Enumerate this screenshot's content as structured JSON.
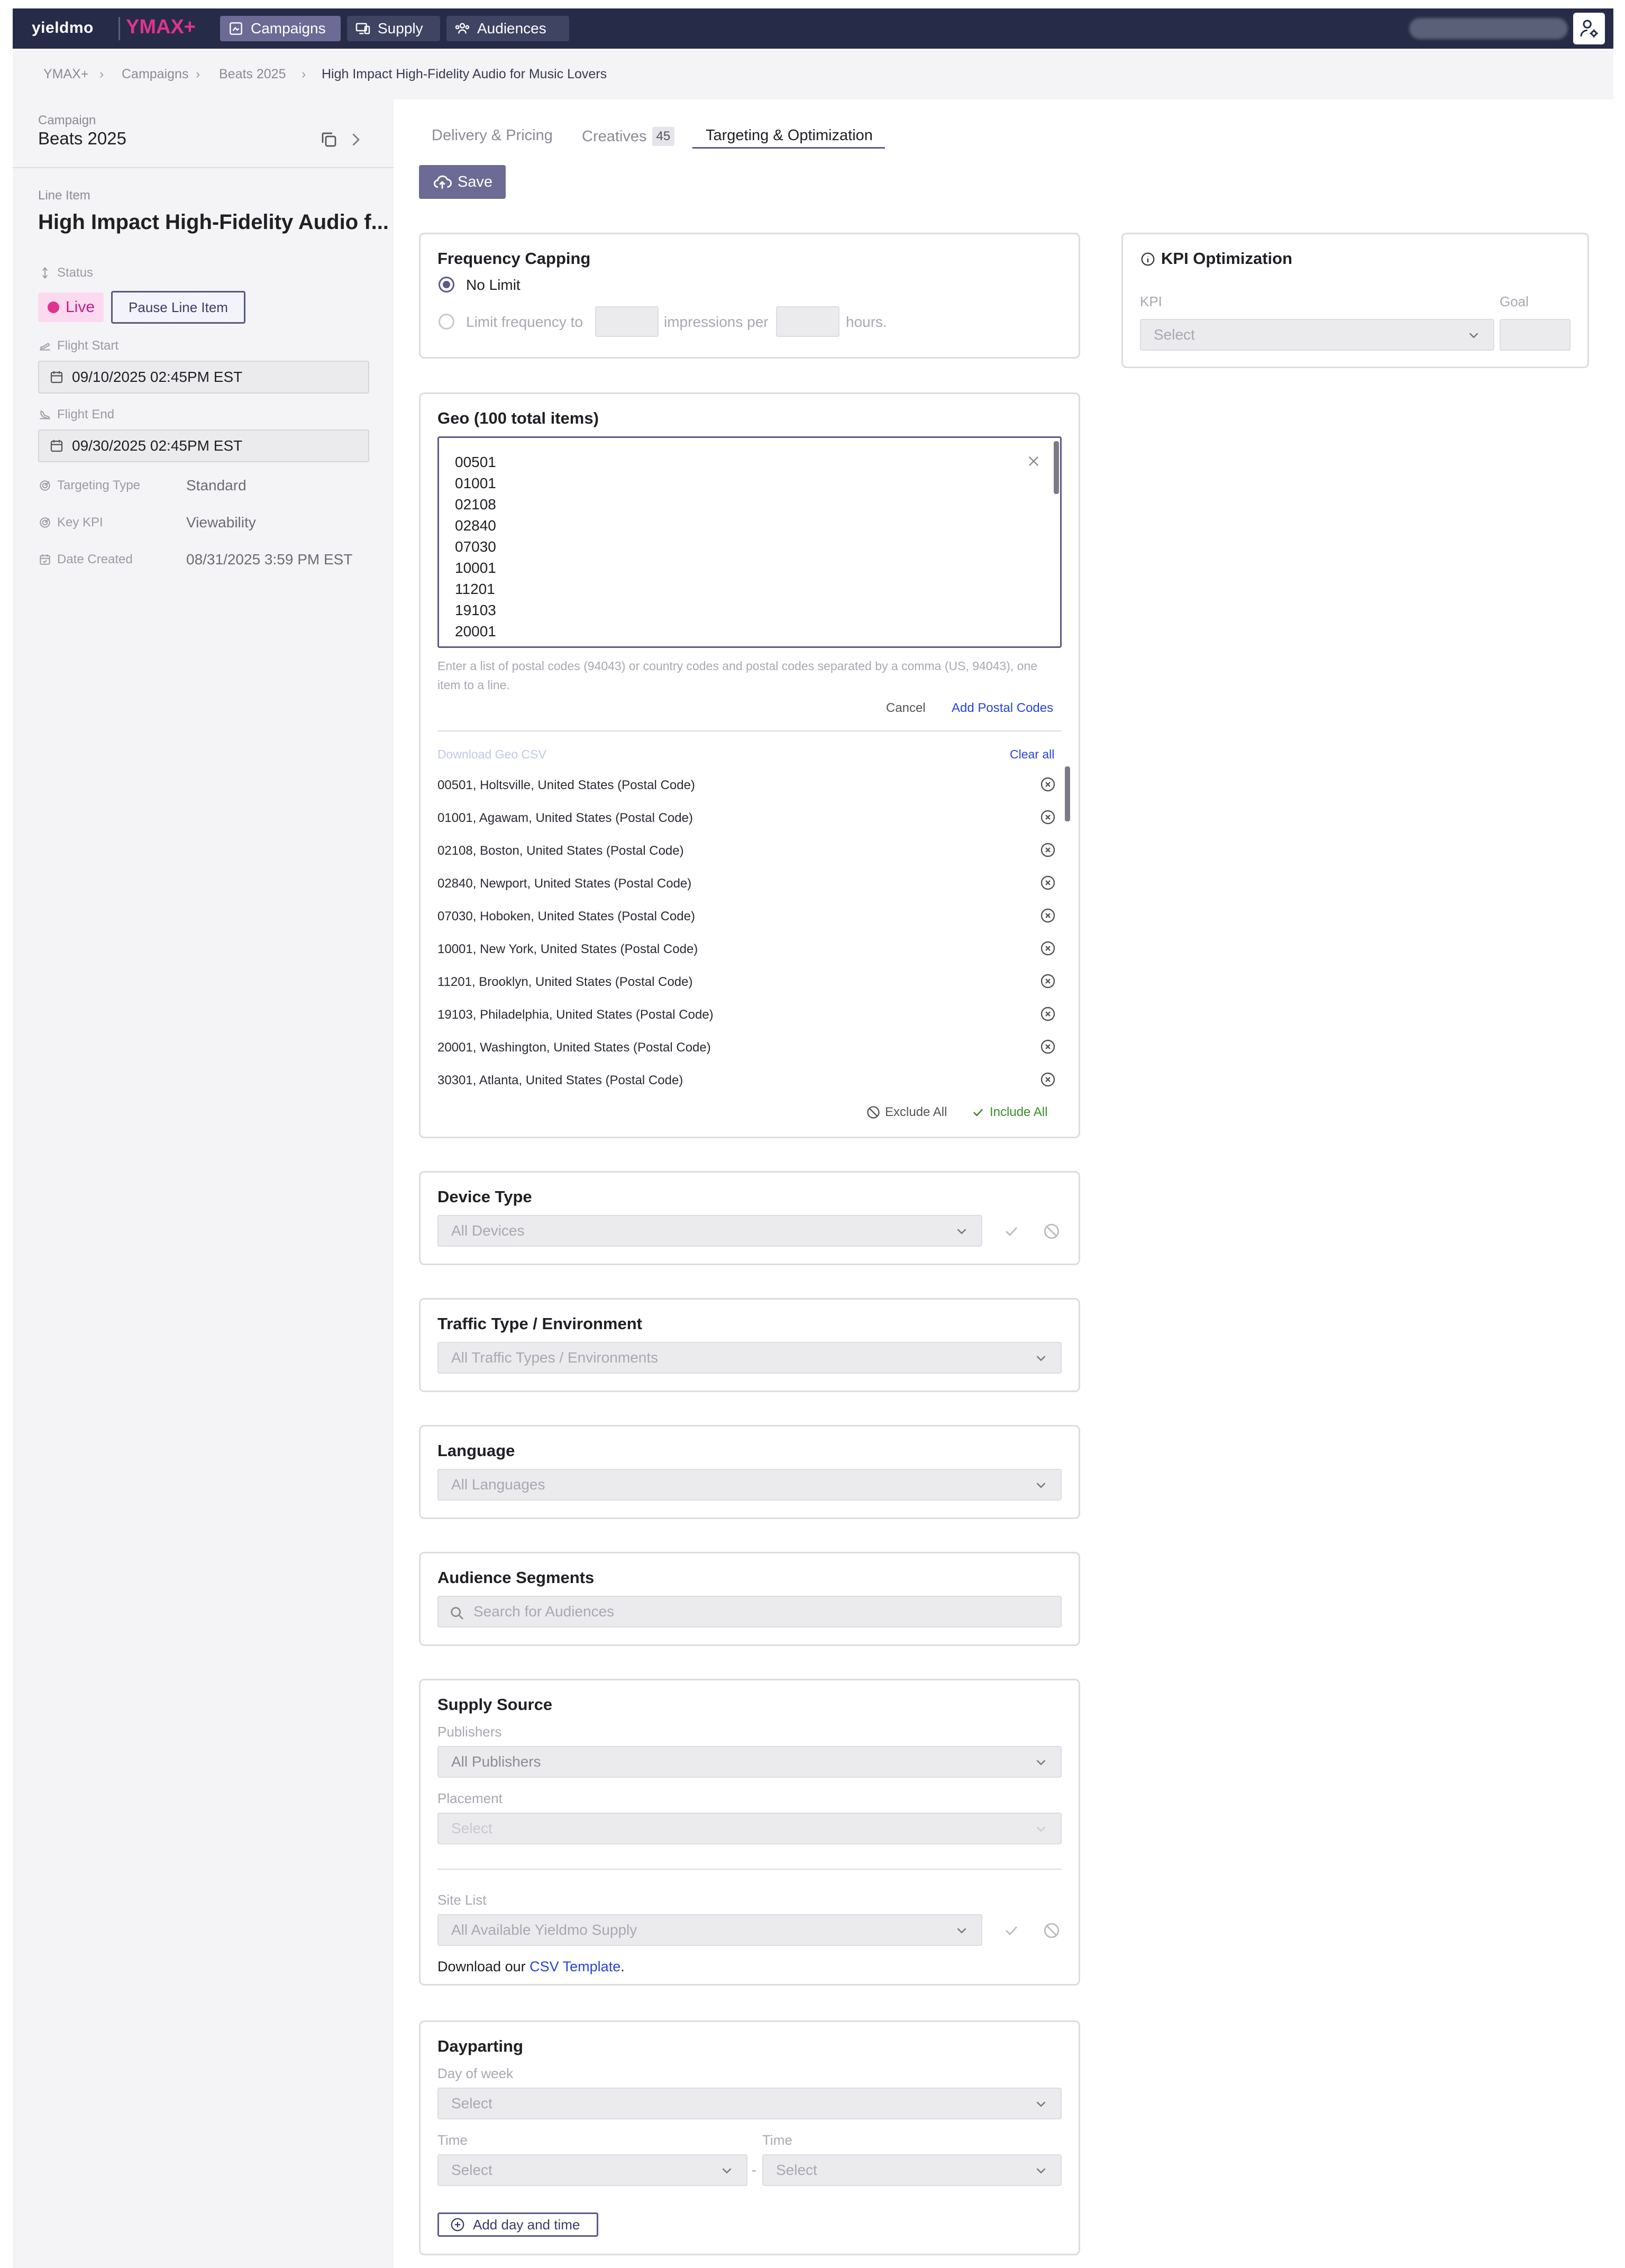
{
  "topnav": {
    "logo": "yieldmo",
    "product": "YMAX+",
    "items": [
      {
        "label": "Campaigns",
        "active": true
      },
      {
        "label": "Supply",
        "active": false
      },
      {
        "label": "Audiences",
        "active": false
      }
    ]
  },
  "breadcrumb": [
    "YMAX+",
    "Campaigns",
    "Beats 2025",
    "High Impact High-Fidelity Audio for Music Lovers"
  ],
  "sidebar": {
    "campaign_label": "Campaign",
    "campaign_name": "Beats 2025",
    "line_item_label": "Line Item",
    "line_item_name": "High Impact High-Fidelity Audio f...",
    "status_label": "Status",
    "status_value": "Live",
    "pause_button": "Pause Line Item",
    "flight_start_label": "Flight Start",
    "flight_start_value": "09/10/2025 02:45PM EST",
    "flight_end_label": "Flight End",
    "flight_end_value": "09/30/2025 02:45PM EST",
    "targeting_type_label": "Targeting Type",
    "targeting_type_value": "Standard",
    "key_kpi_label": "Key KPI",
    "key_kpi_value": "Viewability",
    "date_created_label": "Date Created",
    "date_created_value": "08/31/2025 3:59 PM EST"
  },
  "tabs": [
    {
      "label": "Delivery & Pricing"
    },
    {
      "label": "Creatives",
      "count": "45"
    },
    {
      "label": "Targeting & Optimization",
      "active": true
    }
  ],
  "save_label": "Save",
  "frequency": {
    "title": "Frequency Capping",
    "no_limit": "No Limit",
    "limit_to": "Limit frequency to",
    "impressions_per": "impressions per",
    "hours": "hours."
  },
  "geo": {
    "title": "Geo (100 total items)",
    "textarea_lines": [
      "00501",
      "01001",
      "02108",
      "02840",
      "07030",
      "10001",
      "11201",
      "19103",
      "20001"
    ],
    "helper": "Enter a list of postal codes (94043) or country codes and postal codes separated by a comma (US, 94043), one item to a line.",
    "cancel": "Cancel",
    "add_postal": "Add Postal Codes",
    "download_csv": "Download Geo CSV",
    "clear_all": "Clear all",
    "items": [
      "00501, Holtsville, United States (Postal Code)",
      "01001, Agawam, United States (Postal Code)",
      "02108, Boston, United States (Postal Code)",
      "02840, Newport, United States (Postal Code)",
      "07030, Hoboken, United States (Postal Code)",
      "10001, New York, United States (Postal Code)",
      "11201, Brooklyn, United States (Postal Code)",
      "19103, Philadelphia, United States (Postal Code)",
      "20001, Washington, United States (Postal Code)",
      "30301, Atlanta, United States (Postal Code)"
    ],
    "exclude_all": "Exclude All",
    "include_all": "Include All"
  },
  "device": {
    "title": "Device Type",
    "value": "All Devices"
  },
  "traffic": {
    "title": "Traffic Type / Environment",
    "value": "All Traffic Types / Environments"
  },
  "language": {
    "title": "Language",
    "value": "All Languages"
  },
  "audience": {
    "title": "Audience Segments",
    "placeholder": "Search for Audiences"
  },
  "supply": {
    "title": "Supply Source",
    "publishers_label": "Publishers",
    "publishers_value": "All Publishers",
    "placement_label": "Placement",
    "placement_value": "Select",
    "site_list_label": "Site List",
    "site_list_value": "All Available Yieldmo Supply",
    "download_prefix": "Download our",
    "csv_template": "CSV Template",
    "download_suffix": "."
  },
  "dayparting": {
    "title": "Dayparting",
    "day_label": "Day of week",
    "day_value": "Select",
    "time_label_1": "Time",
    "time_value_1": "Select",
    "dash": "-",
    "time_label_2": "Time",
    "time_value_2": "Select",
    "add_button": "Add day and time"
  },
  "kpi": {
    "title": "KPI Optimization",
    "kpi_label": "KPI",
    "kpi_value": "Select",
    "goal_label": "Goal"
  },
  "colors": {
    "nav": "#262b47",
    "accent": "#5c5a88",
    "live": "#e0338f",
    "link": "#2743d9",
    "include": "#3c8c2e"
  }
}
